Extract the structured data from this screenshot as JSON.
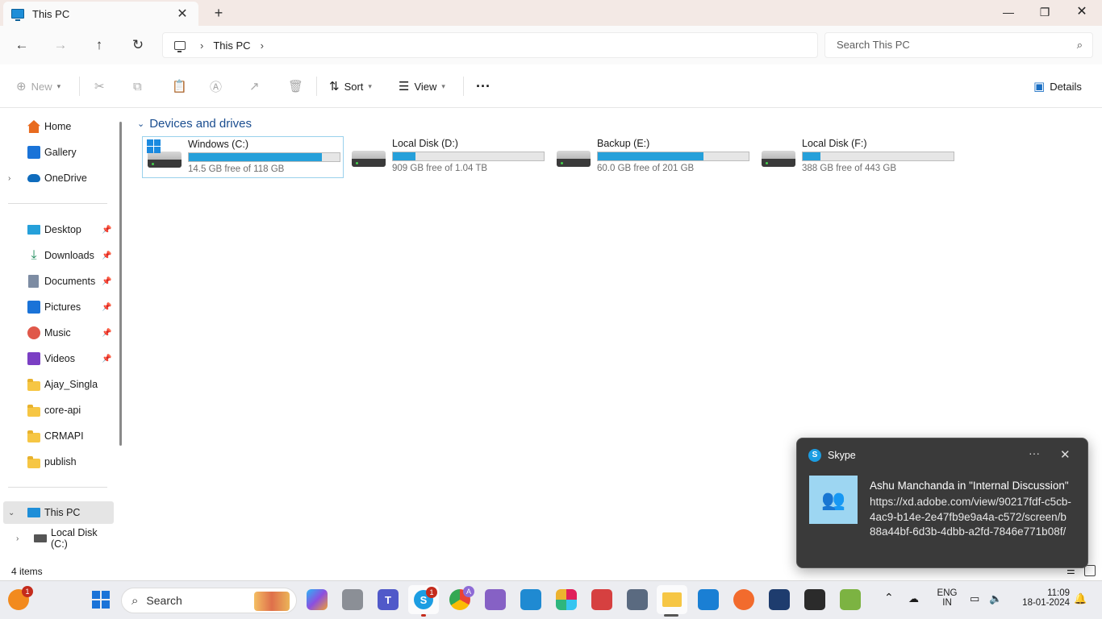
{
  "window": {
    "tab_title": "This PC",
    "new_tab": "+",
    "minimize": "—",
    "maximize": "❐",
    "close": "✕"
  },
  "address": {
    "segments": [
      "This PC"
    ],
    "search_placeholder": "Search This PC"
  },
  "commands": {
    "new": "New",
    "sort": "Sort",
    "view": "View",
    "more": "···",
    "details": "Details"
  },
  "sidebar": {
    "top": [
      {
        "label": "Home",
        "icon": "home-icon"
      },
      {
        "label": "Gallery",
        "icon": "gallery-icon"
      },
      {
        "label": "OneDrive",
        "icon": "onedrive-icon"
      }
    ],
    "quick": [
      {
        "label": "Desktop",
        "icon": "desktop-icon",
        "pinned": true
      },
      {
        "label": "Downloads",
        "icon": "downloads-icon",
        "pinned": true
      },
      {
        "label": "Documents",
        "icon": "documents-icon",
        "pinned": true
      },
      {
        "label": "Pictures",
        "icon": "pictures-icon",
        "pinned": true
      },
      {
        "label": "Music",
        "icon": "music-icon",
        "pinned": true
      },
      {
        "label": "Videos",
        "icon": "videos-icon",
        "pinned": true
      },
      {
        "label": "Ajay_Singla",
        "icon": "folder-icon",
        "pinned": false
      },
      {
        "label": "core-api",
        "icon": "folder-icon",
        "pinned": false
      },
      {
        "label": "CRMAPI",
        "icon": "folder-icon",
        "pinned": false
      },
      {
        "label": "publish",
        "icon": "folder-icon",
        "pinned": false
      }
    ],
    "this_pc": "This PC",
    "local_disk_c": "Local Disk (C:)"
  },
  "content": {
    "group_title": "Devices and drives",
    "drives": [
      {
        "name": "Windows (C:)",
        "free_text": "14.5 GB free of 118 GB",
        "used_fraction": 0.88,
        "is_system": true
      },
      {
        "name": "Local Disk (D:)",
        "free_text": "909 GB free of 1.04 TB",
        "used_fraction": 0.15,
        "is_system": false
      },
      {
        "name": "Backup (E:)",
        "free_text": "60.0 GB free of 201 GB",
        "used_fraction": 0.7,
        "is_system": false
      },
      {
        "name": "Local Disk (F:)",
        "free_text": "388 GB free of 443 GB",
        "used_fraction": 0.12,
        "is_system": false
      }
    ]
  },
  "status": {
    "item_count": "4 items"
  },
  "notification": {
    "app": "Skype",
    "app_initial": "S",
    "more": "···",
    "close": "✕",
    "title": "Ashu Manchanda in \"Internal Discussion\"",
    "body": "https://xd.adobe.com/view/90217fdf-c5cb-4ac9-b14e-2e47fb9e9a4a-c572/screen/b88a44bf-6d3b-4dbb-a2fd-7846e771b08f/"
  },
  "taskbar": {
    "search_label": "Search",
    "notification_badge": "1",
    "skype_badge": "1",
    "chrome_badge": "A",
    "teams_letter": "T",
    "lang_top": "ENG",
    "lang_bottom": "IN",
    "time": "11:09",
    "date": "18-01-2024"
  },
  "colors": {
    "accent": "#26a0da",
    "group_header": "#1a4d8f",
    "toast_bg": "#3a3a3a"
  }
}
